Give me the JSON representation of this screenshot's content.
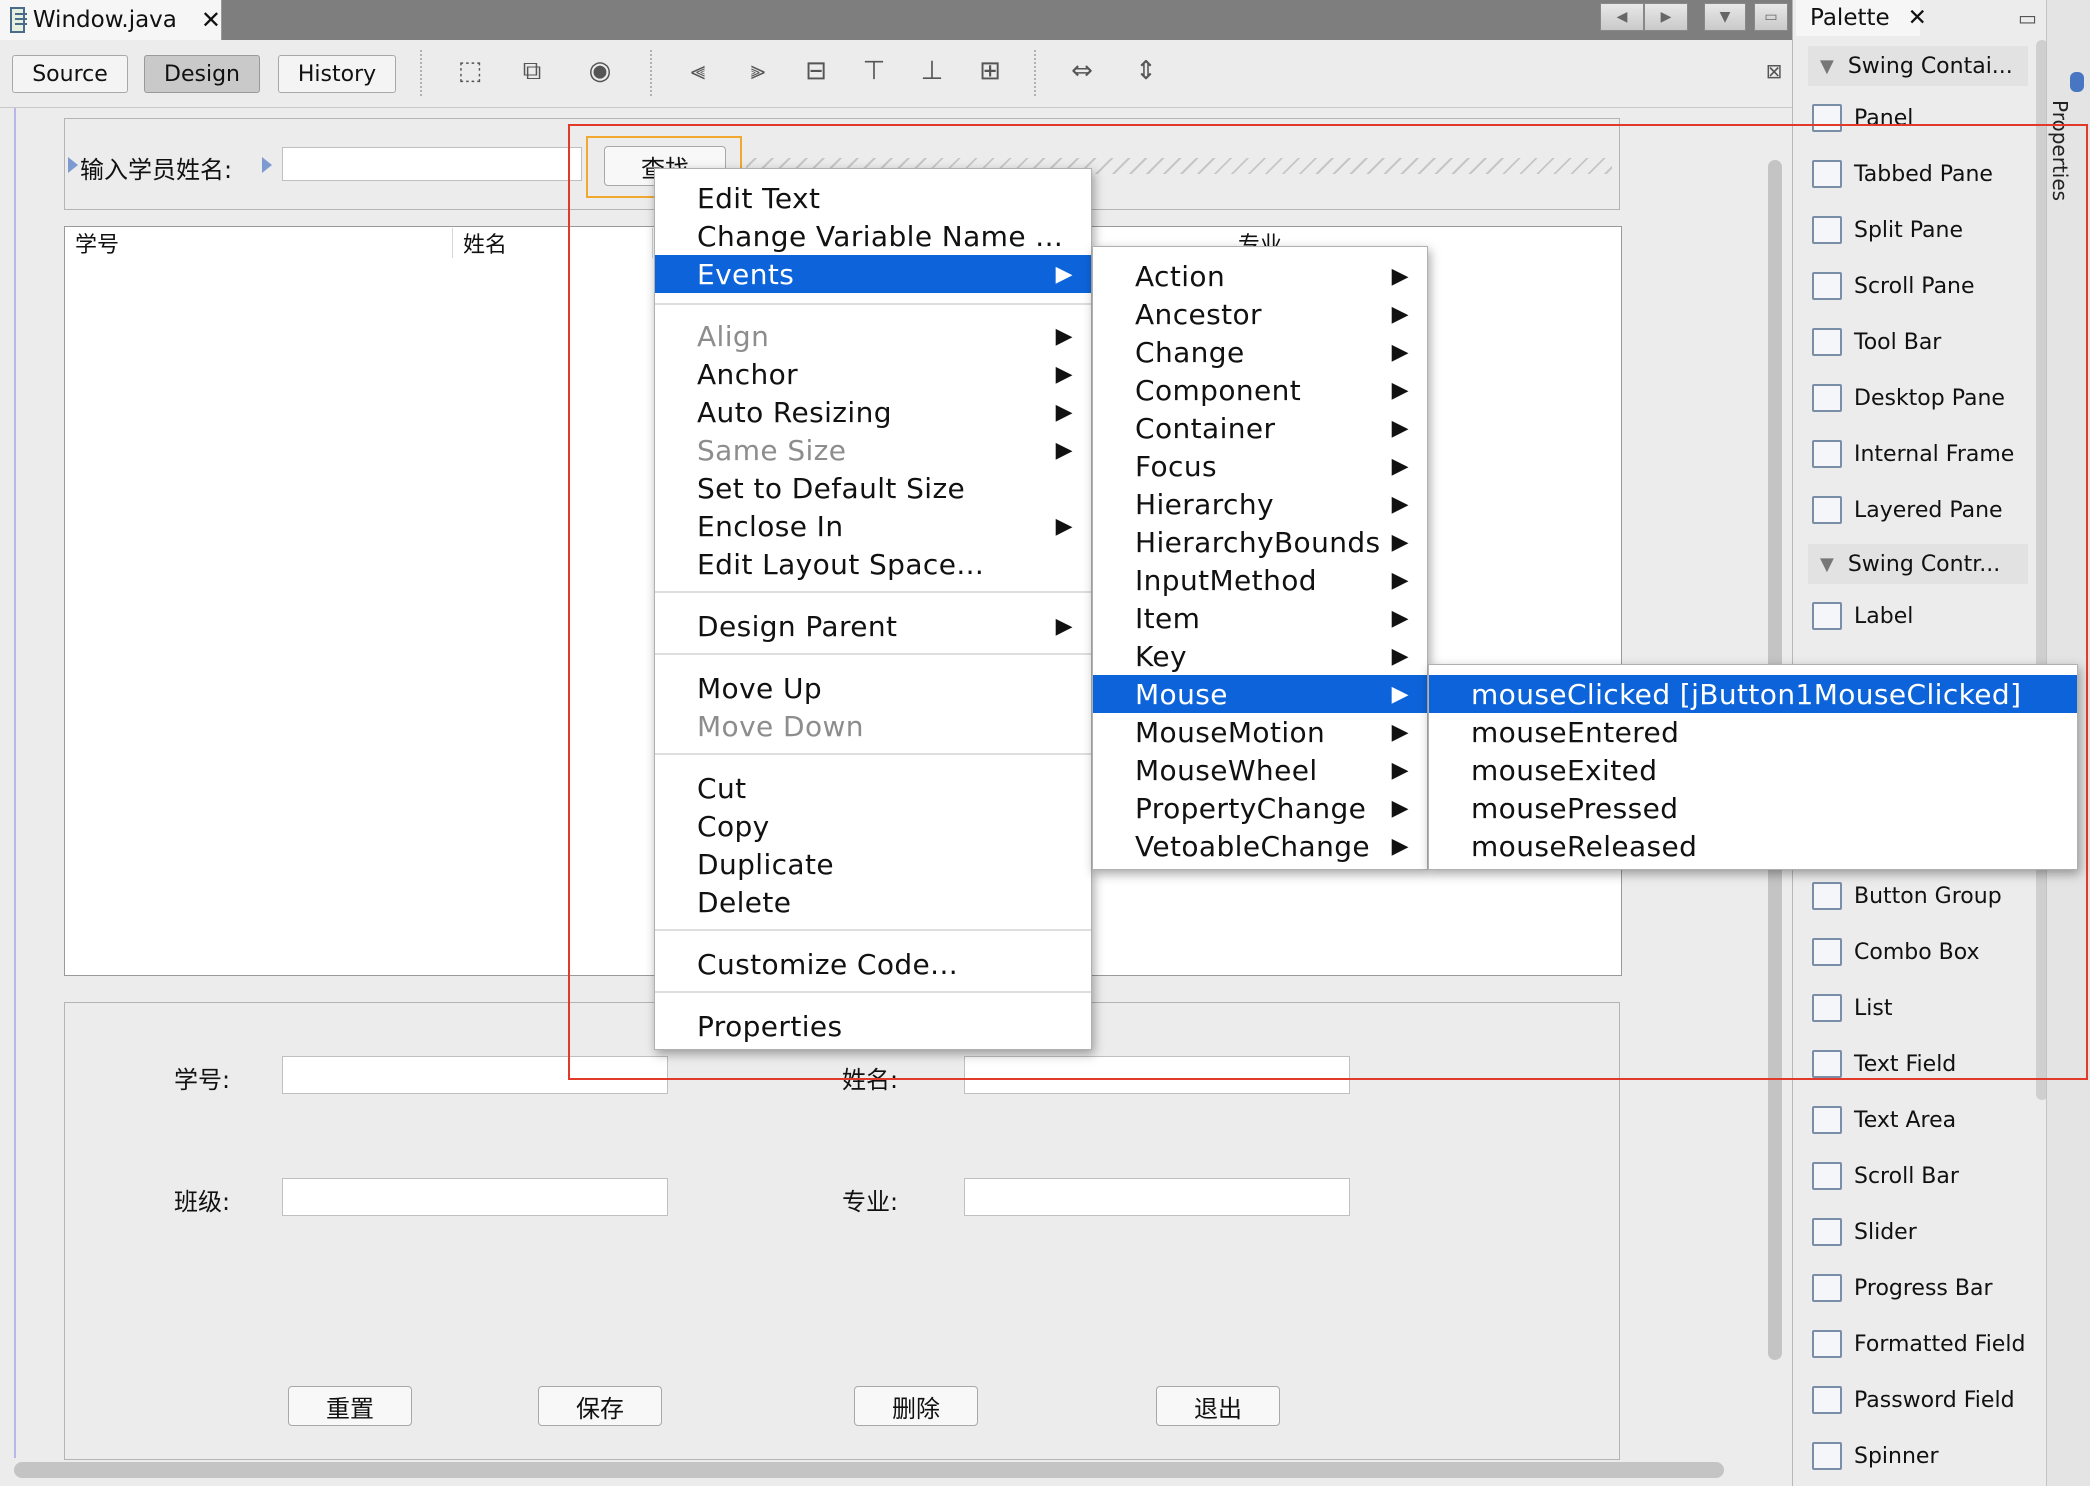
{
  "editor": {
    "tab_title": "Window.java",
    "close_glyph": "✕",
    "views": {
      "source": "Source",
      "design": "Design",
      "history": "History"
    }
  },
  "form": {
    "search_label": "输入学员姓名:",
    "search_button": "查找",
    "table_headers": [
      "学号",
      "姓名",
      "专业"
    ],
    "labels": {
      "id": "学号:",
      "name": "姓名:",
      "class": "班级:",
      "major": "专业:"
    },
    "buttons": {
      "reset": "重置",
      "save": "保存",
      "delete": "删除",
      "exit": "退出"
    }
  },
  "palette": {
    "title": "Palette",
    "close_glyph": "✕",
    "categories": {
      "containers": "Swing Contai...",
      "controls": "Swing Contr..."
    },
    "items": {
      "panel": "Panel",
      "tabbed_pane": "Tabbed Pane",
      "split_pane": "Split Pane",
      "scroll_pane": "Scroll Pane",
      "tool_bar": "Tool Bar",
      "desktop_pane": "Desktop Pane",
      "internal_frame": "Internal Frame",
      "layered_pane": "Layered Pane",
      "label": "Label",
      "button_group": "Button Group",
      "combo_box": "Combo Box",
      "list": "List",
      "text_field": "Text Field",
      "text_area": "Text Area",
      "scroll_bar": "Scroll Bar",
      "slider": "Slider",
      "progress_bar": "Progress Bar",
      "formatted_field": "Formatted Field",
      "password_field": "Password Field",
      "spinner": "Spinner"
    }
  },
  "properties_tab": "Properties",
  "context_menu": {
    "items": {
      "edit_text": "Edit Text",
      "change_var": "Change Variable Name ...",
      "events": "Events",
      "align": "Align",
      "anchor": "Anchor",
      "auto_resizing": "Auto Resizing",
      "same_size": "Same Size",
      "default_size": "Set to Default Size",
      "enclose_in": "Enclose In",
      "edit_layout_space": "Edit Layout Space...",
      "design_parent": "Design Parent",
      "move_up": "Move Up",
      "move_down": "Move Down",
      "cut": "Cut",
      "copy": "Copy",
      "duplicate": "Duplicate",
      "delete": "Delete",
      "customize_code": "Customize Code...",
      "properties": "Properties"
    }
  },
  "events_menu": {
    "items": {
      "action": "Action",
      "ancestor": "Ancestor",
      "change": "Change",
      "component": "Component",
      "container": "Container",
      "focus": "Focus",
      "hierarchy": "Hierarchy",
      "hierarchy_bounds": "HierarchyBounds",
      "input_method": "InputMethod",
      "item": "Item",
      "key": "Key",
      "mouse": "Mouse",
      "mouse_motion": "MouseMotion",
      "mouse_wheel": "MouseWheel",
      "property_change": "PropertyChange",
      "vetoable_change": "VetoableChange"
    }
  },
  "mouse_menu": {
    "items": {
      "clicked": "mouseClicked [jButton1MouseClicked]",
      "entered": "mouseEntered",
      "exited": "mouseExited",
      "pressed": "mousePressed",
      "released": "mouseReleased"
    }
  },
  "colors": {
    "selection": "#0d63d9",
    "guide_red": "#e23a2a",
    "component_selection": "#f0a830"
  }
}
